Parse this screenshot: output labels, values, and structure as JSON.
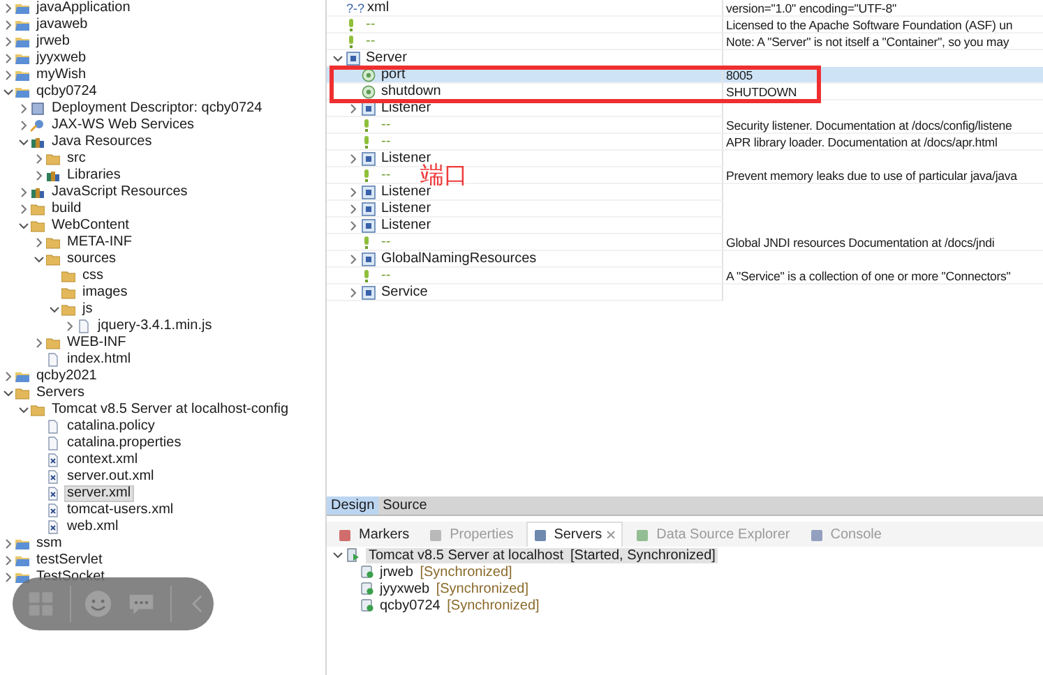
{
  "project_tree": [
    {
      "label": "javaApplication",
      "kind": "project",
      "expanded": false
    },
    {
      "label": "javaweb",
      "kind": "project",
      "expanded": false
    },
    {
      "label": "jrweb",
      "kind": "project",
      "expanded": false
    },
    {
      "label": "jyyxweb",
      "kind": "project",
      "expanded": false
    },
    {
      "label": "myWish",
      "kind": "project",
      "expanded": false
    },
    {
      "label": "qcby0724",
      "kind": "project",
      "expanded": true,
      "children": [
        {
          "label": "Deployment Descriptor: qcby0724",
          "kind": "descriptor",
          "expanded": false
        },
        {
          "label": "JAX-WS Web Services",
          "kind": "service",
          "expanded": false
        },
        {
          "label": "Java Resources",
          "kind": "library",
          "expanded": true,
          "children": [
            {
              "label": "src",
              "kind": "folder",
              "expanded": false
            },
            {
              "label": "Libraries",
              "kind": "library",
              "expanded": false
            }
          ]
        },
        {
          "label": "JavaScript Resources",
          "kind": "library",
          "expanded": false
        },
        {
          "label": "build",
          "kind": "folder",
          "expanded": false
        },
        {
          "label": "WebContent",
          "kind": "folder",
          "expanded": true,
          "children": [
            {
              "label": "META-INF",
              "kind": "folder",
              "expanded": false
            },
            {
              "label": "sources",
              "kind": "folder",
              "expanded": true,
              "children": [
                {
                  "label": "css",
                  "kind": "folder"
                },
                {
                  "label": "images",
                  "kind": "folder"
                },
                {
                  "label": "js",
                  "kind": "folder",
                  "expanded": true,
                  "children": [
                    {
                      "label": "jquery-3.4.1.min.js",
                      "kind": "file",
                      "expanded": false
                    }
                  ]
                }
              ]
            },
            {
              "label": "WEB-INF",
              "kind": "folder",
              "expanded": false
            },
            {
              "label": "index.html",
              "kind": "file"
            }
          ]
        }
      ]
    },
    {
      "label": "qcby2021",
      "kind": "project",
      "expanded": false
    },
    {
      "label": "Servers",
      "kind": "folder",
      "expanded": true,
      "children": [
        {
          "label": "Tomcat v8.5 Server at localhost-config",
          "kind": "folder",
          "expanded": true,
          "children": [
            {
              "label": "catalina.policy",
              "kind": "file"
            },
            {
              "label": "catalina.properties",
              "kind": "file"
            },
            {
              "label": "context.xml",
              "kind": "xml"
            },
            {
              "label": "server.out.xml",
              "kind": "xml"
            },
            {
              "label": "server.xml",
              "kind": "xml",
              "selected": true
            },
            {
              "label": "tomcat-users.xml",
              "kind": "xml",
              "selected": false
            },
            {
              "label": "web.xml",
              "kind": "xml",
              "selected": false
            }
          ]
        }
      ]
    },
    {
      "label": "ssm",
      "kind": "project",
      "expanded": false
    },
    {
      "label": "testServlet",
      "kind": "project",
      "expanded": false
    },
    {
      "label": "TestSocket",
      "kind": "project",
      "expanded": false
    }
  ],
  "xml_tree": [
    {
      "kind": "pi",
      "marker": "?-?",
      "name": "xml",
      "value": "version=\"1.0\" encoding=\"UTF-8\""
    },
    {
      "kind": "comment",
      "name": "--",
      "value": "Licensed to the Apache Software Foundation (ASF) un"
    },
    {
      "kind": "comment",
      "name": "--",
      "value": "Note:  A \"Server\" is not itself a \"Container\", so you may"
    },
    {
      "kind": "element",
      "name": "Server",
      "expanded": true,
      "children": [
        {
          "kind": "attribute",
          "name": "port",
          "value": "8005",
          "selected": true
        },
        {
          "kind": "attribute",
          "name": "shutdown",
          "value": "SHUTDOWN",
          "selected": false
        },
        {
          "kind": "element",
          "name": "Listener",
          "expanded": false
        },
        {
          "kind": "comment",
          "name": "--",
          "value": "Security listener. Documentation at /docs/config/listene"
        },
        {
          "kind": "comment",
          "name": "--",
          "value": "APR library loader. Documentation at /docs/apr.html"
        },
        {
          "kind": "element",
          "name": "Listener",
          "expanded": false
        },
        {
          "kind": "comment",
          "name": "--",
          "value": "Prevent memory leaks due to use of particular java/java",
          "note": "端口"
        },
        {
          "kind": "element",
          "name": "Listener",
          "expanded": false
        },
        {
          "kind": "element",
          "name": "Listener",
          "expanded": false
        },
        {
          "kind": "element",
          "name": "Listener",
          "expanded": false
        },
        {
          "kind": "comment",
          "name": "--",
          "value": "Global JNDI resources       Documentation at /docs/jndi"
        },
        {
          "kind": "element",
          "name": "GlobalNamingResources",
          "expanded": false
        },
        {
          "kind": "comment",
          "name": "--",
          "value": "A \"Service\" is a collection of one or more \"Connectors\""
        },
        {
          "kind": "element",
          "name": "Service",
          "expanded": false
        }
      ]
    }
  ],
  "editor_tabs": [
    {
      "label": "Design",
      "selected": true
    },
    {
      "label": "Source",
      "selected": false
    }
  ],
  "view_tabs": [
    {
      "label": "Markers",
      "selected": false,
      "disabled": false
    },
    {
      "label": "Properties",
      "selected": false,
      "disabled": true
    },
    {
      "label": "Servers",
      "selected": true,
      "disabled": false
    },
    {
      "label": "Data Source Explorer",
      "selected": false,
      "disabled": true
    },
    {
      "label": "Console",
      "selected": false,
      "disabled": true
    }
  ],
  "servers": [
    {
      "name": "Tomcat v8.5 Server at localhost",
      "status": "[Started, Synchronized]",
      "expanded": true,
      "selected": true,
      "children": [
        {
          "name": "jrweb",
          "status": "[Synchronized]"
        },
        {
          "name": "jyyxweb",
          "status": "[Synchronized]"
        },
        {
          "name": "qcby0724",
          "status": "[Synchronized]"
        }
      ]
    }
  ]
}
